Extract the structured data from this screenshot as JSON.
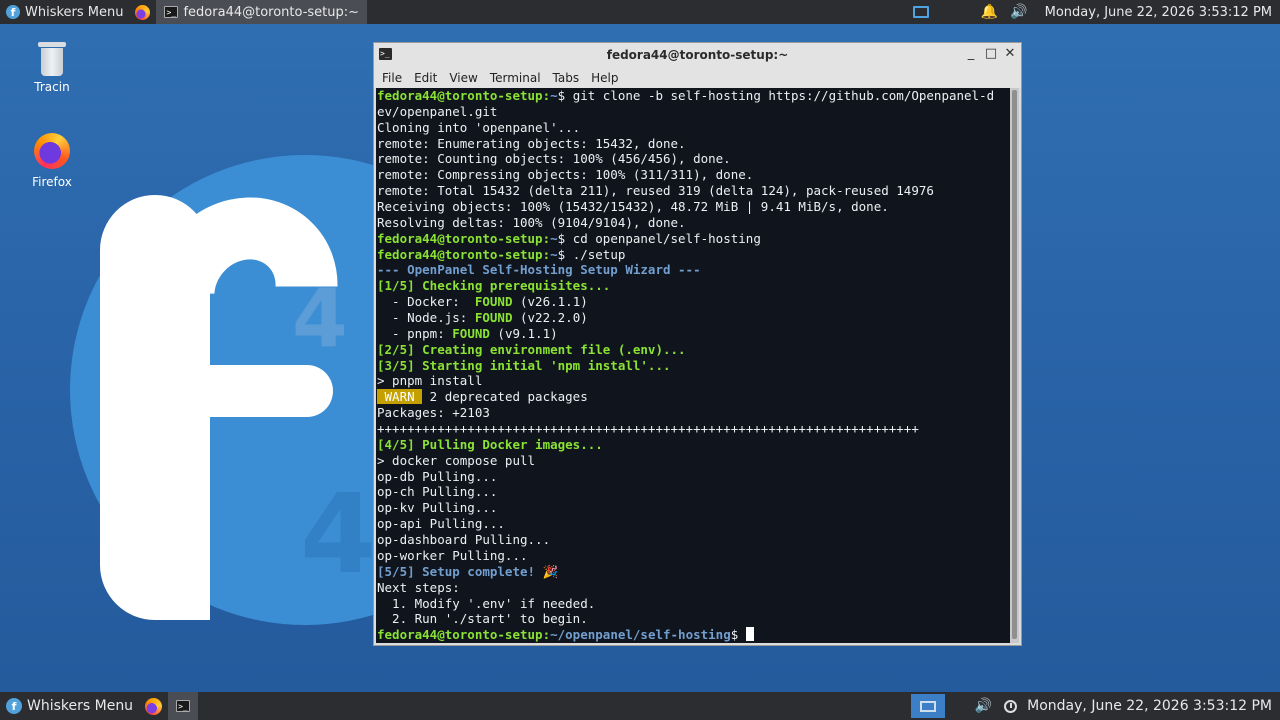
{
  "top_panel": {
    "menu_label": "Whiskers Menu",
    "task_label": "fedora44@toronto-setup:~",
    "clock": "Monday, June 22, 2026  3:53:12 PM"
  },
  "bottom_panel": {
    "menu_label": "Whiskers Menu",
    "clock": "Monday, June 22, 2026  3:53:12 PM"
  },
  "desktop": {
    "icons": [
      {
        "label": "Tracin"
      },
      {
        "label": "Firefox"
      }
    ],
    "logo_numbers": [
      "4",
      "4"
    ]
  },
  "terminal_window": {
    "title": "fedora44@toronto-setup:~",
    "menu": [
      "File",
      "Edit",
      "View",
      "Terminal",
      "Tabs",
      "Help"
    ],
    "prompt_user": "fedora44@toronto-setup",
    "lines": [
      {
        "prompt": "fedora44@toronto-setup",
        "path": "~",
        "cmd": " git clone -b self-hosting https://github.com/Openpanel-d"
      },
      {
        "text": "ev/openpanel.git"
      },
      {
        "text": "Cloning into 'openpanel'..."
      },
      {
        "text": "remote: Enumerating objects: 15432, done."
      },
      {
        "text": "remote: Counting objects: 100% (456/456), done."
      },
      {
        "text": "remote: Compressing objects: 100% (311/311), done."
      },
      {
        "text": "remote: Total 15432 (delta 211), reused 319 (delta 124), pack-reused 14976"
      },
      {
        "text": "Receiving objects: 100% (15432/15432), 48.72 MiB | 9.41 MiB/s, done."
      },
      {
        "text": "Resolving deltas: 100% (9104/9104), done."
      },
      {
        "prompt": "fedora44@toronto-setup",
        "path": "~",
        "cmd": " cd openpanel/self-hosting"
      },
      {
        "prompt": "fedora44@toronto-setup",
        "path": "~",
        "cmd": " ./setup"
      },
      {
        "blue": "--- OpenPanel Self-Hosting Setup Wizard ---"
      },
      {
        "green": "[1/5] Checking prerequisites..."
      },
      {
        "pre": "  - Docker:  ",
        "found": "FOUND",
        "post": " (v26.1.1)"
      },
      {
        "pre": "  - Node.js: ",
        "found": "FOUND",
        "post": " (v22.2.0)"
      },
      {
        "pre": "  - pnpm: ",
        "found": "FOUND",
        "post": " (v9.1.1)"
      },
      {
        "green": "[2/5] Creating environment file (.env)..."
      },
      {
        "green": "[3/5] Starting initial 'npm install'..."
      },
      {
        "text": "> pnpm install"
      },
      {
        "warn": " WARN ",
        "post": " 2 deprecated packages"
      },
      {
        "text": "Packages: +2103"
      },
      {
        "text": "++++++++++++++++++++++++++++++++++++++++++++++++++++++++++++++++++++++++"
      },
      {
        "green": "[4/5] Pulling Docker images..."
      },
      {
        "text": "> docker compose pull"
      },
      {
        "text": "op-db Pulling..."
      },
      {
        "text": "op-ch Pulling..."
      },
      {
        "text": "op-kv Pulling..."
      },
      {
        "text": "op-api Pulling..."
      },
      {
        "text": "op-dashboard Pulling..."
      },
      {
        "text": "op-worker Pulling..."
      },
      {
        "blue": "[5/5] Setup complete! ",
        "post": "🎉"
      },
      {
        "text": "Next steps:"
      },
      {
        "text": "  1. Modify '.env' if needed."
      },
      {
        "text": "  2. Run './start' to begin."
      },
      {
        "prompt": "fedora44@toronto-setup",
        "path": "~/openpanel/self-hosting",
        "cmd": " ",
        "cursor": true
      }
    ]
  }
}
